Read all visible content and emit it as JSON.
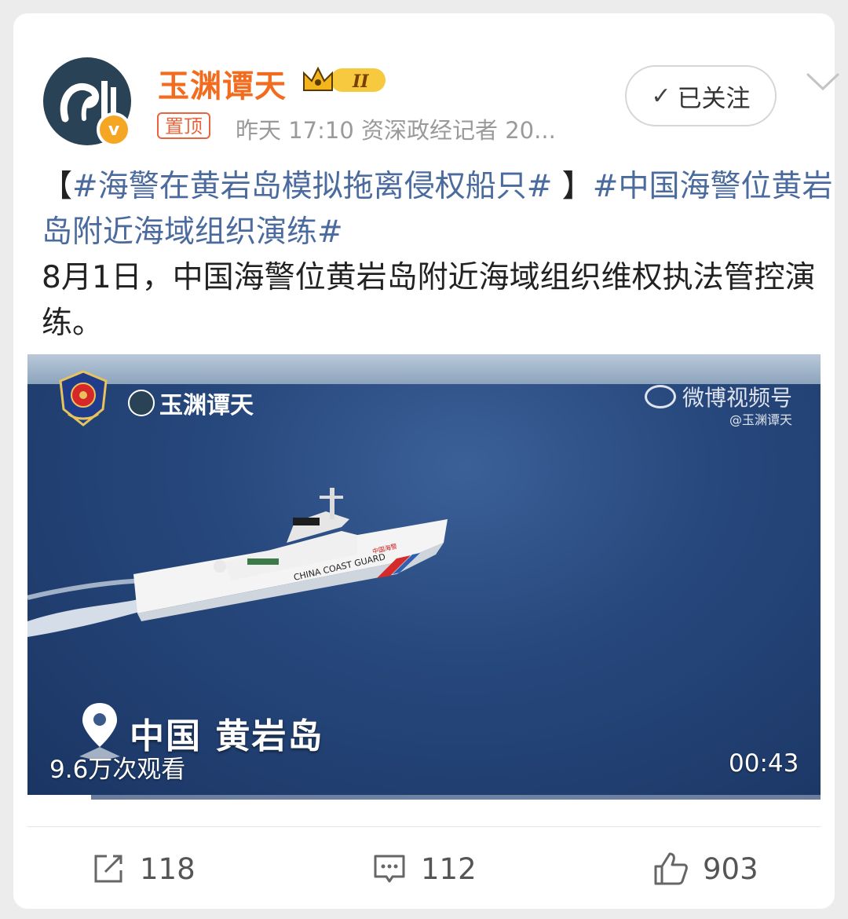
{
  "post": {
    "author": "玉渊谭天",
    "pinned_label": "置顶",
    "meta_line": "昨天 17:10 资深政经记者 20...",
    "follow_label": "已关注",
    "topic_1": "#海警在黄岩岛模拟拖离侵权船只#",
    "topic_2": "#中国海警位黄岩岛附近海域组织演练#",
    "bracket_open": "【",
    "bracket_close": " 】",
    "body": "8月1日，中国海警位黄岩岛附近海域组织维权执法管控演练。"
  },
  "video": {
    "watermark_author": "玉渊谭天",
    "watermark_weibo": "微博视频号",
    "watermark_handle": "@玉渊谭天",
    "location": "中国 黄岩岛",
    "views": "9.6万次观看",
    "duration": "00:43",
    "progress": 0.08,
    "ship_hull_text": "CHINA COAST GUARD",
    "ship_hull_text_cn": "中国海警"
  },
  "actions": {
    "reposts": "118",
    "comments": "112",
    "likes": "903"
  },
  "icons": {
    "avatar": "avatar",
    "verified": "verified-badge-icon",
    "level": "crown-level-icon",
    "follow_check": "check-icon",
    "more": "chevron-down-icon",
    "repost": "repost-icon",
    "comment": "comment-icon",
    "like": "thumbs-up-icon"
  },
  "colors": {
    "author": "#f26c1f",
    "topic": "#4b6b9e",
    "pinned": "#e8643c"
  }
}
